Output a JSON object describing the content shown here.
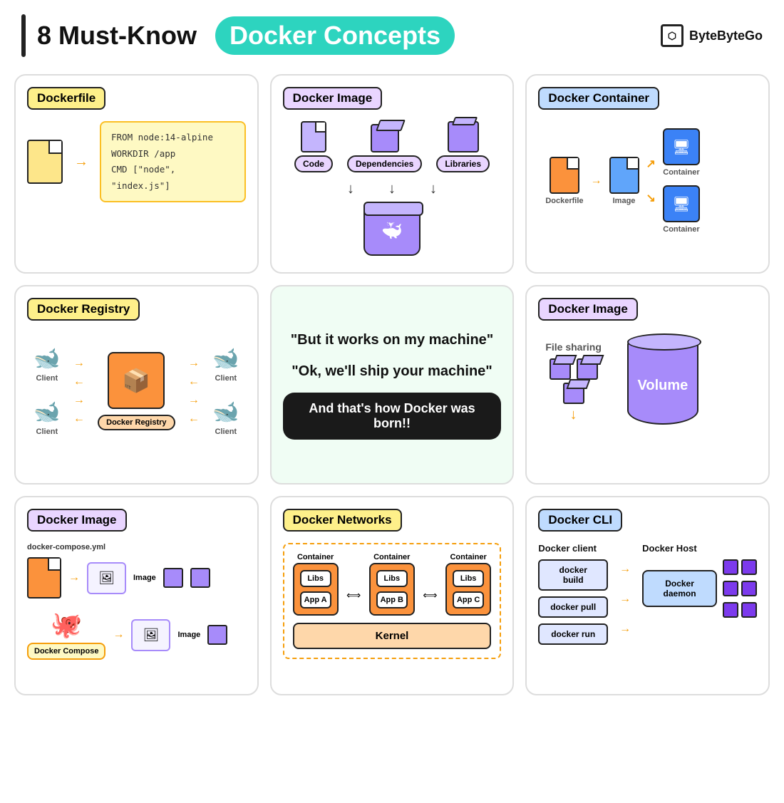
{
  "header": {
    "bar_color": "#222",
    "title_static": "8 Must-Know",
    "title_highlight": "Docker Concepts",
    "logo_text": "ByteByteGo"
  },
  "cards": {
    "dockerfile": {
      "title": "Dockerfile",
      "code_lines": [
        "FROM node:14-alpine",
        "WORKDIR /app",
        "CMD [\"node\", \"index.js\"]"
      ]
    },
    "docker_image_top": {
      "title": "Docker Image",
      "labels": [
        "Code",
        "Dependencies",
        "Libraries"
      ]
    },
    "docker_container": {
      "title": "Docker Container",
      "labels": [
        "Dockerfile",
        "Image",
        "Container",
        "Container"
      ]
    },
    "docker_registry": {
      "title": "Docker Registry",
      "client_label": "Client",
      "registry_label": "Docker Registry"
    },
    "quote": {
      "quote1": "\"But it works on my machine\"",
      "quote2": "\"Ok, we'll ship your machine\"",
      "quote3": "And that's how Docker was born!!"
    },
    "docker_image_volume": {
      "title": "Docker Image",
      "file_sharing": "File sharing",
      "volume": "Volume"
    },
    "docker_image_compose": {
      "title": "Docker Image",
      "yml_label": "docker-compose.yml",
      "image_label": "Image",
      "compose_label": "Docker Compose"
    },
    "docker_networks": {
      "title": "Docker Networks",
      "containers": [
        "Container",
        "Container",
        "Container"
      ],
      "libs": [
        "Libs",
        "Libs",
        "Libs"
      ],
      "apps": [
        "App A",
        "App B",
        "App C"
      ],
      "kernel": "Kernel"
    },
    "docker_cli": {
      "title": "Docker CLI",
      "client_label": "Docker client",
      "host_label": "Docker Host",
      "buttons": [
        "docker build",
        "docker pull",
        "docker run"
      ],
      "daemon": "Docker daemon"
    }
  }
}
